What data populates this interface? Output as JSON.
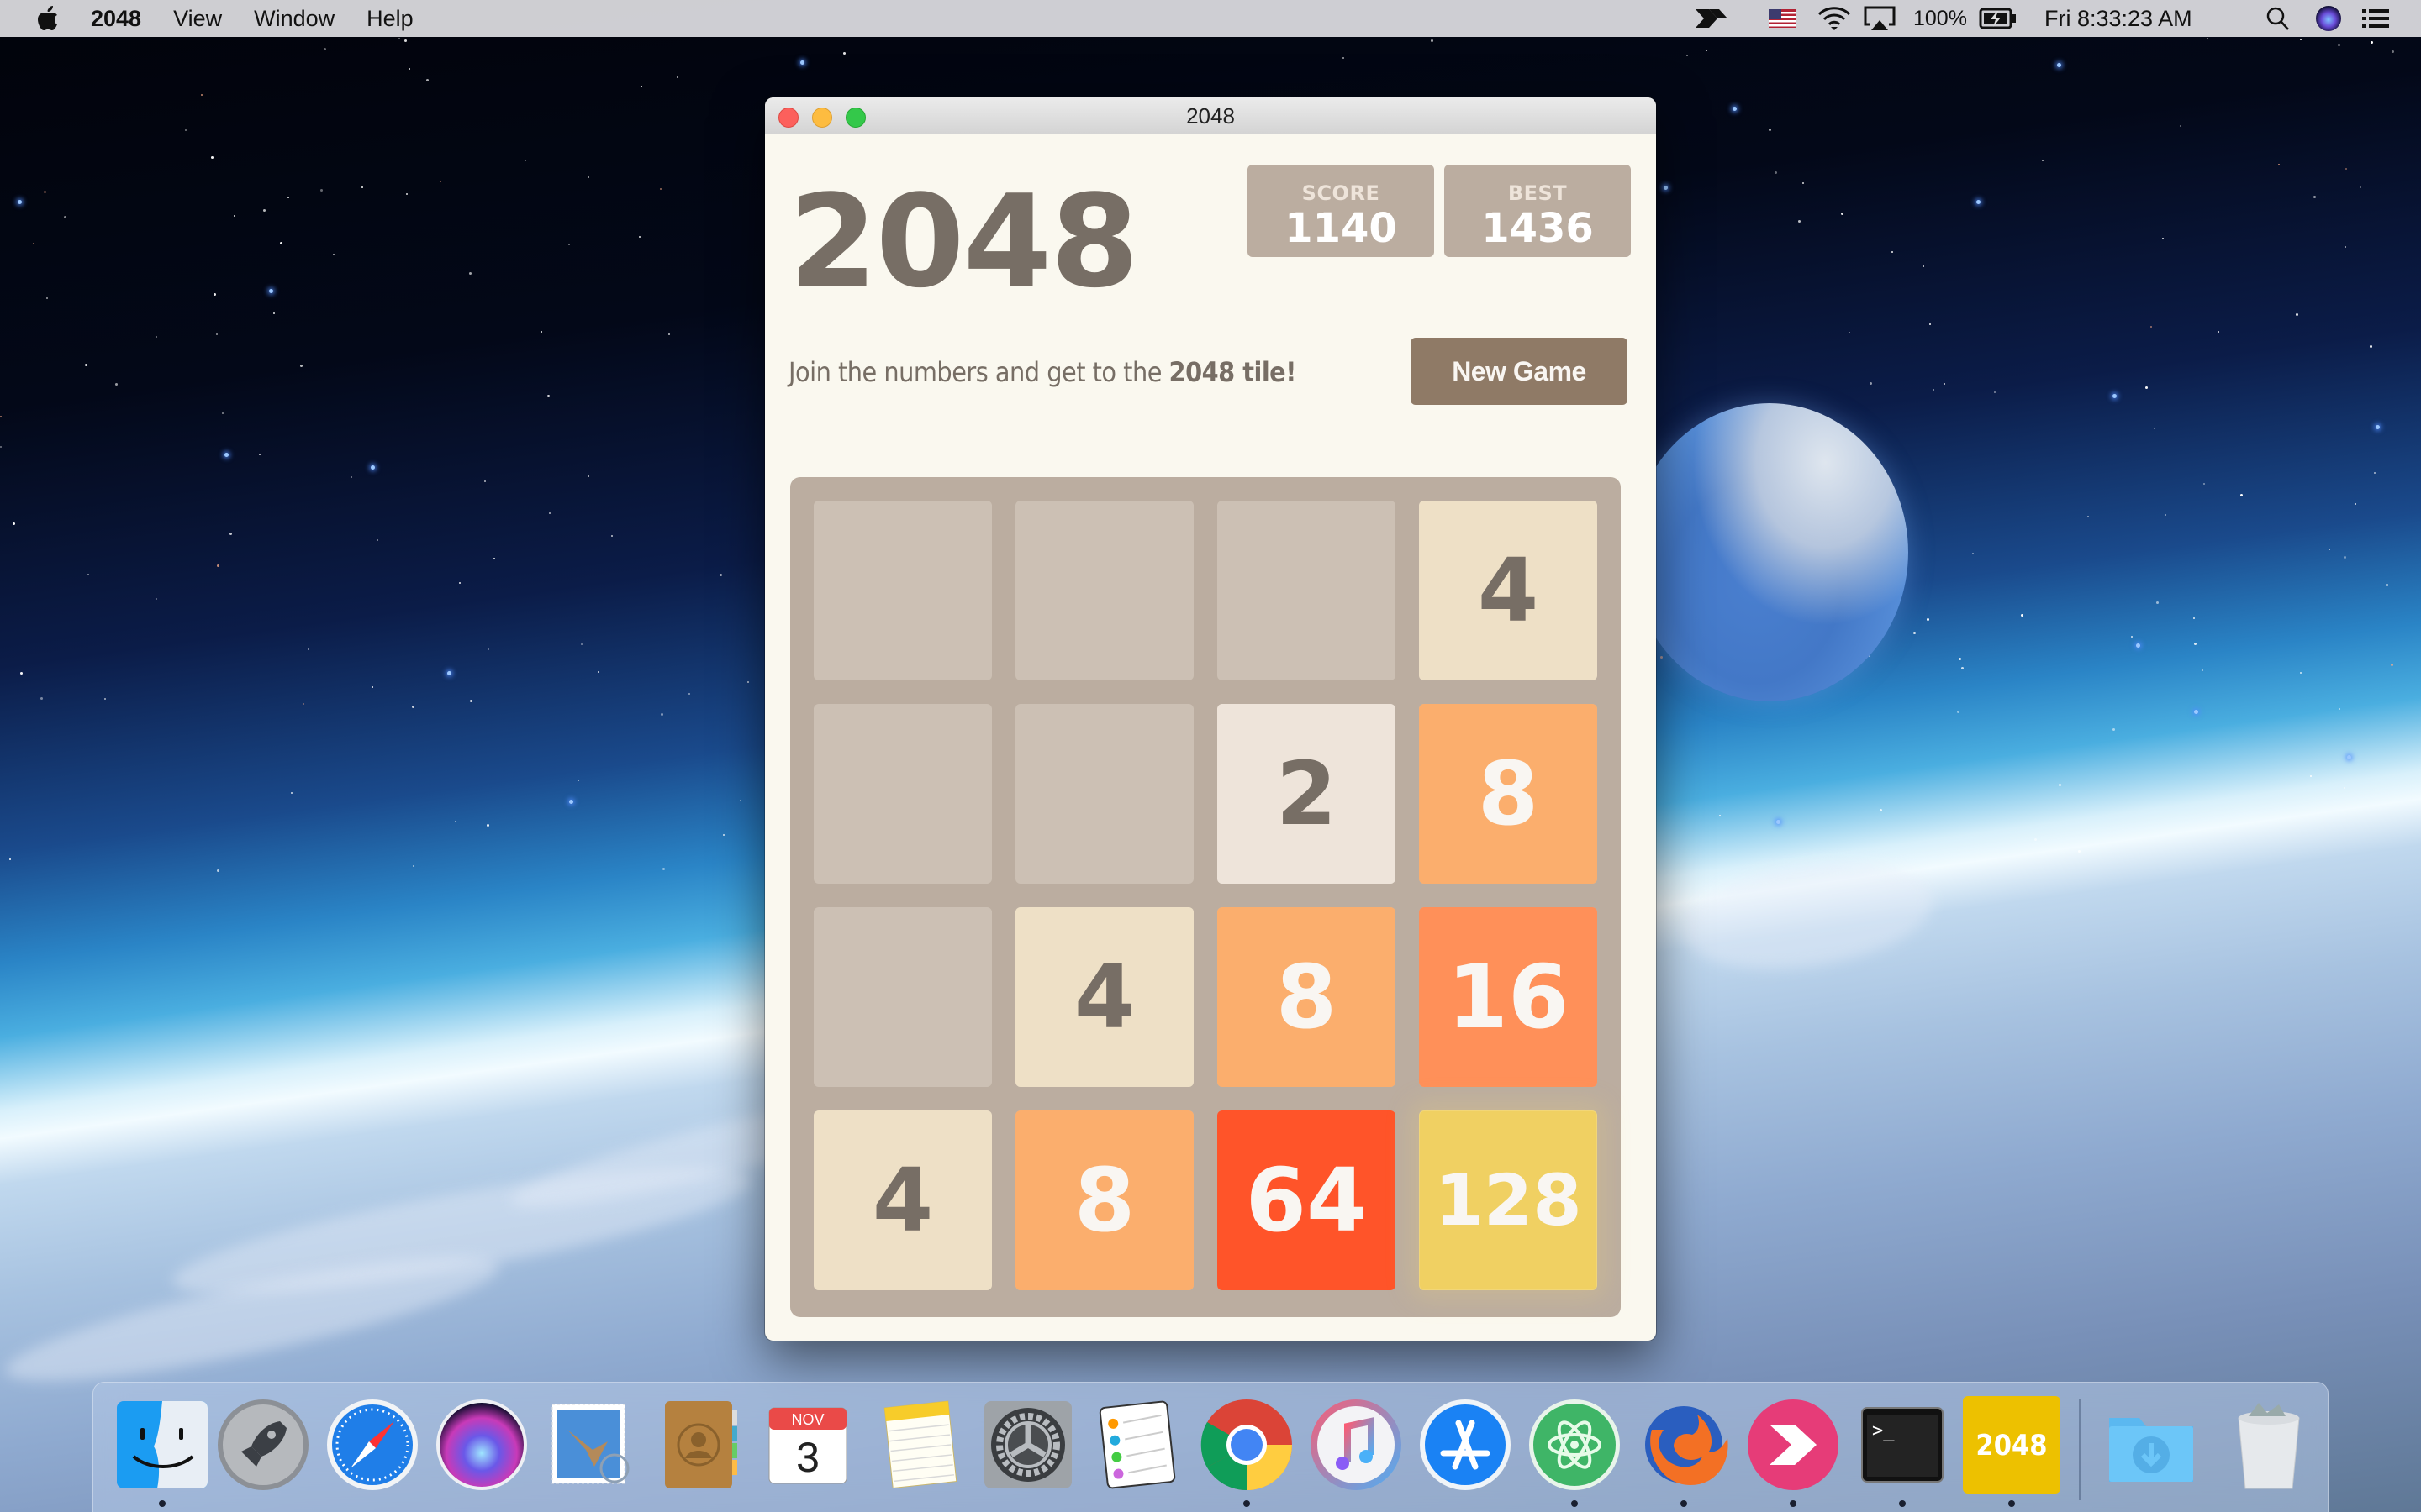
{
  "menubar": {
    "app_name": "2048",
    "menus": [
      "View",
      "Window",
      "Help"
    ],
    "status": {
      "battery_percent": "100%",
      "clock": "Fri 8:33:23 AM"
    },
    "icons": [
      "apple-logo",
      "spark-app-icon",
      "us-flag-input-icon",
      "wifi-icon",
      "airplay-icon",
      "battery-charging-icon",
      "spotlight-search-icon",
      "siri-icon",
      "notification-center-icon"
    ]
  },
  "window": {
    "title": "2048",
    "game": {
      "title": "2048",
      "score_label": "SCORE",
      "score": "1140",
      "best_label": "BEST",
      "best": "1436",
      "intro_text": "Join the numbers and get to the ",
      "intro_bold": "2048 tile!",
      "new_game_label": "New Game",
      "grid": [
        [
          null,
          null,
          null,
          4
        ],
        [
          null,
          null,
          2,
          8
        ],
        [
          null,
          4,
          8,
          16
        ],
        [
          4,
          8,
          64,
          128
        ]
      ],
      "tile_colors": {
        "2": {
          "bg": "#eee4da",
          "fg": "#776e65"
        },
        "4": {
          "bg": "#eee0c6",
          "fg": "#776e65"
        },
        "8": {
          "bg": "#fbae6d",
          "fg": "#f9f6f2"
        },
        "16": {
          "bg": "#ff9059",
          "fg": "#f9f6f2"
        },
        "64": {
          "bg": "#ff5429",
          "fg": "#f9f6f2"
        },
        "128": {
          "bg": "#f0d062",
          "fg": "#f9f6f2"
        }
      }
    }
  },
  "dock": {
    "apps": [
      {
        "name": "Finder",
        "running": true
      },
      {
        "name": "Launchpad",
        "running": false
      },
      {
        "name": "Safari",
        "running": false
      },
      {
        "name": "Siri",
        "running": false
      },
      {
        "name": "Mail",
        "running": false
      },
      {
        "name": "Contacts",
        "running": false
      },
      {
        "name": "Calendar",
        "running": false,
        "month": "NOV",
        "day": "3"
      },
      {
        "name": "Notes",
        "running": false
      },
      {
        "name": "System Preferences",
        "running": false
      },
      {
        "name": "Reminders",
        "running": false
      },
      {
        "name": "Google Chrome",
        "running": true
      },
      {
        "name": "iTunes",
        "running": false
      },
      {
        "name": "App Store",
        "running": false
      },
      {
        "name": "Atom",
        "running": true
      },
      {
        "name": "Firefox",
        "running": true
      },
      {
        "name": "Skitch",
        "running": true
      },
      {
        "name": "Terminal",
        "running": true,
        "glyph": ">_"
      },
      {
        "name": "2048",
        "running": true,
        "label": "2048"
      }
    ],
    "others": [
      {
        "name": "Downloads"
      },
      {
        "name": "Trash"
      }
    ]
  }
}
